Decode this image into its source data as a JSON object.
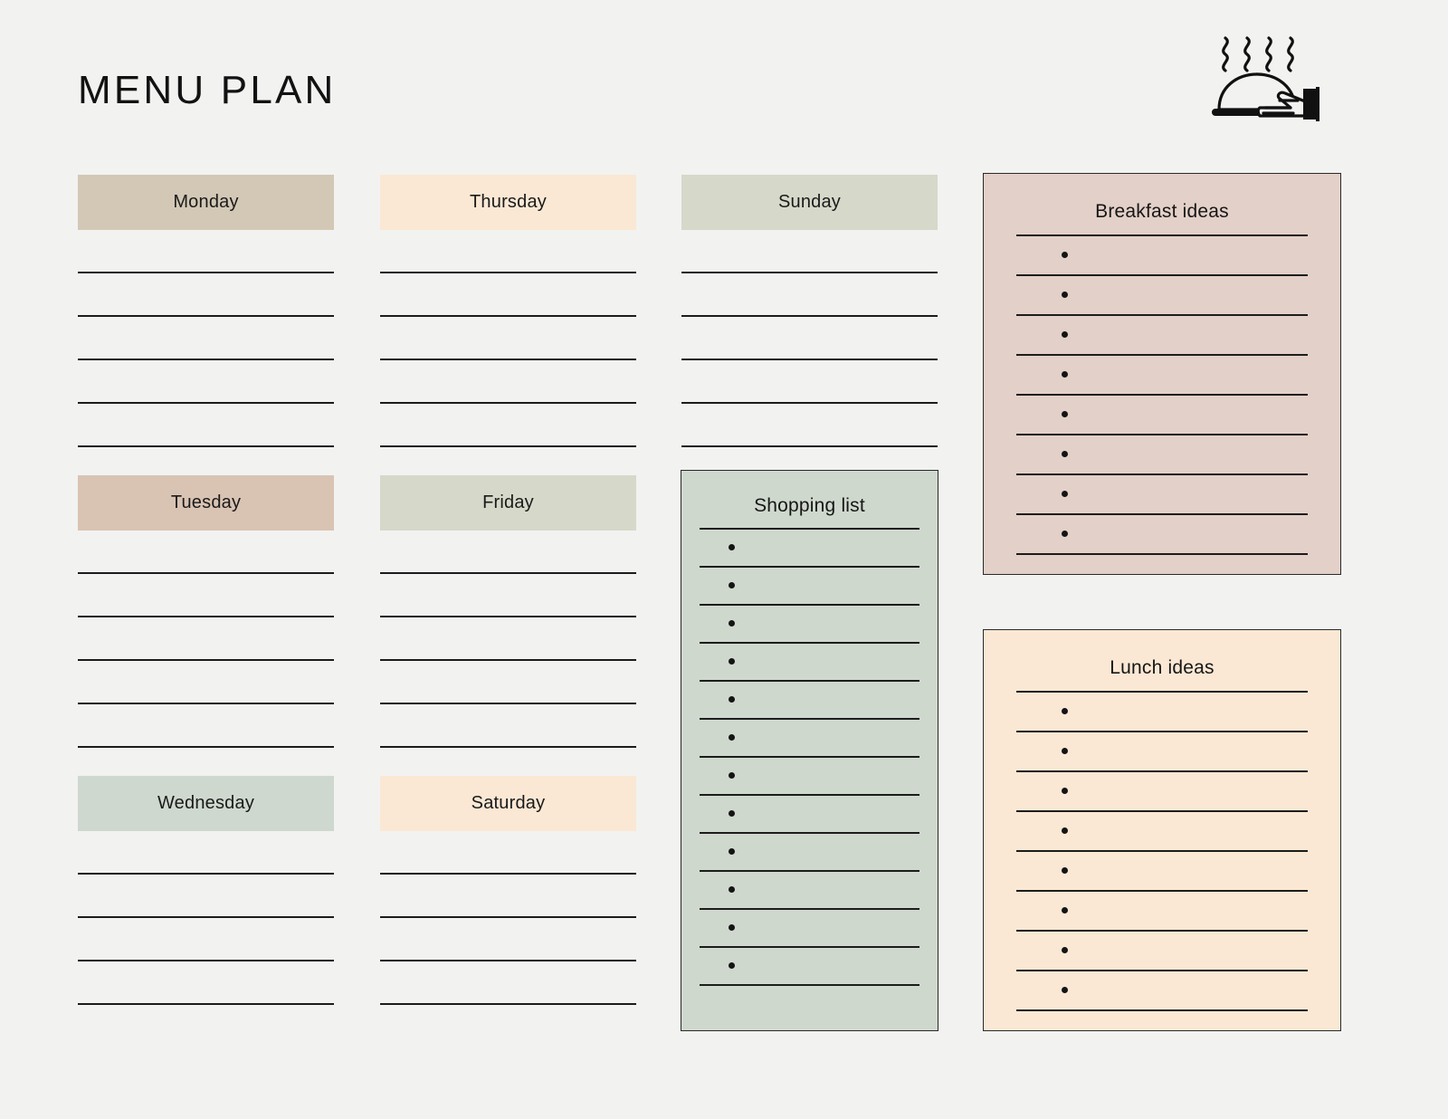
{
  "page": {
    "title": "MENU PLAN",
    "background_color": "#f2f2f1",
    "icon": "cloche-serving-dome-with-hand-icon"
  },
  "days": [
    {
      "label": "Monday",
      "color": "#d3c8b6",
      "lines": 5,
      "column": 1,
      "row": 1
    },
    {
      "label": "Tuesday",
      "color": "#d9c3b3",
      "lines": 5,
      "column": 1,
      "row": 2
    },
    {
      "label": "Wednesday",
      "color": "#ced8cf",
      "lines": 4,
      "column": 1,
      "row": 3
    },
    {
      "label": "Thursday",
      "color": "#fae8d4",
      "lines": 5,
      "column": 2,
      "row": 1
    },
    {
      "label": "Friday",
      "color": "#d6d8c9",
      "lines": 5,
      "column": 2,
      "row": 2
    },
    {
      "label": "Saturday",
      "color": "#fae8d4",
      "lines": 4,
      "column": 2,
      "row": 3
    },
    {
      "label": "Sunday",
      "color": "#d6d8c9",
      "lines": 5,
      "column": 3,
      "row": 1
    }
  ],
  "notes": {
    "breakfast": {
      "title": "Breakfast ideas",
      "background_color": "#e3d0c8",
      "border_color": "#2a2a2a",
      "bullets": 8,
      "items": [
        "",
        "",
        "",
        "",
        "",
        "",
        "",
        ""
      ]
    },
    "lunch": {
      "title": "Lunch ideas",
      "background_color": "#fae8d4",
      "border_color": "#2a2a2a",
      "bullets": 8,
      "items": [
        "",
        "",
        "",
        "",
        "",
        "",
        "",
        ""
      ]
    },
    "shopping": {
      "title": "Shopping list",
      "background_color": "#cfd8cd",
      "border_color": "#2a2a2a",
      "bullets": 12,
      "items": [
        "",
        "",
        "",
        "",
        "",
        "",
        "",
        "",
        "",
        "",
        "",
        ""
      ]
    }
  }
}
